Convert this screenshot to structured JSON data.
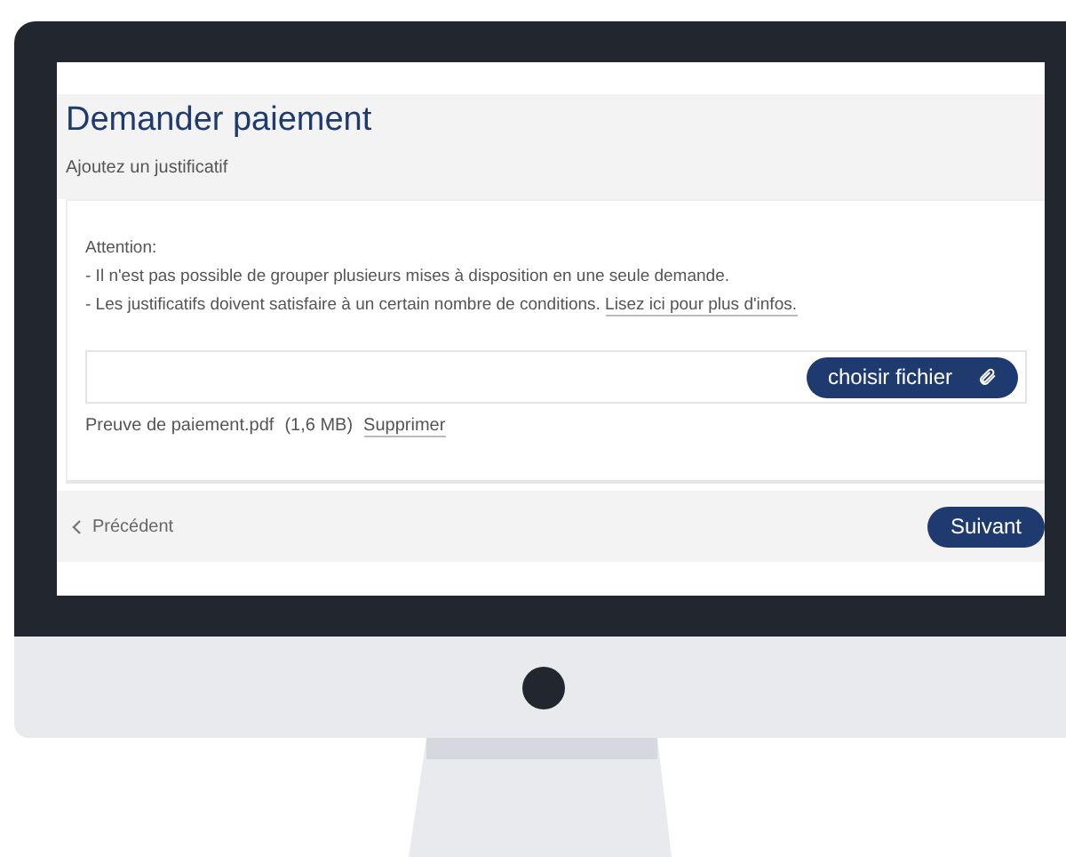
{
  "page": {
    "title": "Demander paiement",
    "subtitle": "Ajoutez un justificatif"
  },
  "notice": {
    "heading": "Attention:",
    "lines": [
      {
        "text": "- Il n'est pas possible de grouper plusieurs mises à disposition en une seule demande."
      },
      {
        "text": "- Les justificatifs doivent satisfaire à un certain nombre de conditions.",
        "link": "Lisez ici pour plus d'infos."
      }
    ]
  },
  "upload": {
    "button": "choisir fichier",
    "file_name": "Preuve de paiement.pdf",
    "file_size": "(1,6 MB)",
    "remove": "Supprimer"
  },
  "footer": {
    "back": "Précédent",
    "next": "Suivant"
  }
}
